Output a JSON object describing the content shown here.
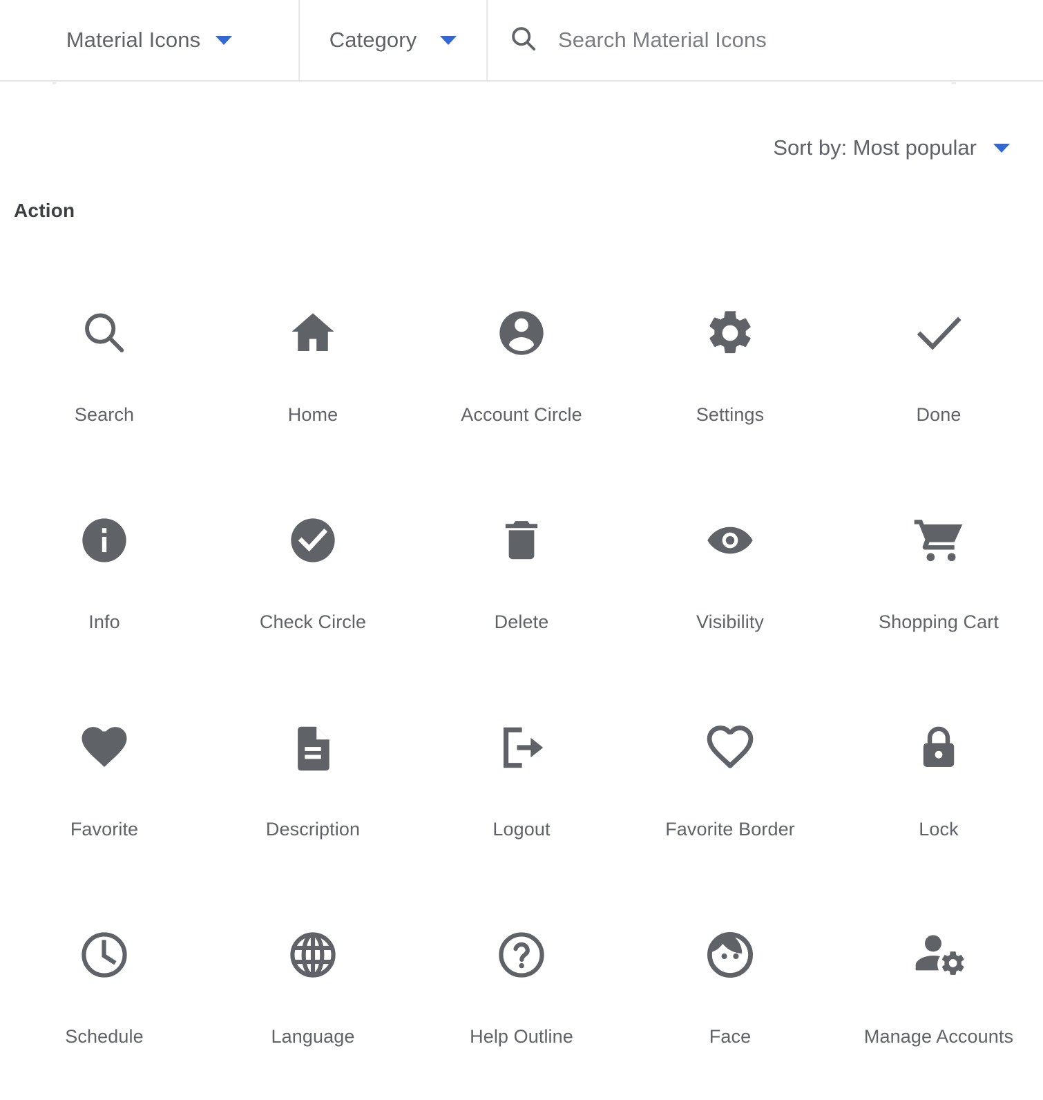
{
  "toolbar": {
    "iconset_label": "Material Icons",
    "category_label": "Category",
    "search_placeholder": "Search Material Icons",
    "search_value": "",
    "search_icon": "search-icon",
    "caret_icon": "chevron-down-icon",
    "caret_color": "#3367d6"
  },
  "sort": {
    "label": "Sort by: Most popular",
    "caret_icon": "chevron-down-icon"
  },
  "section": {
    "heading": "Action"
  },
  "colors": {
    "icon_fill": "#5f6368",
    "label_text": "#5f6368",
    "heading_text": "#3c4043",
    "accent_blue": "#3367d6",
    "divider": "#e7e7ec",
    "background": "#ffffff"
  },
  "grid": {
    "columns": 5,
    "items": [
      {
        "label": "Search",
        "icon": "search-icon"
      },
      {
        "label": "Home",
        "icon": "home-icon"
      },
      {
        "label": "Account Circle",
        "icon": "account-circle-icon"
      },
      {
        "label": "Settings",
        "icon": "gear-icon"
      },
      {
        "label": "Done",
        "icon": "check-icon"
      },
      {
        "label": "Info",
        "icon": "info-icon"
      },
      {
        "label": "Check Circle",
        "icon": "check-circle-icon"
      },
      {
        "label": "Delete",
        "icon": "trash-icon"
      },
      {
        "label": "Visibility",
        "icon": "eye-icon"
      },
      {
        "label": "Shopping Cart",
        "icon": "shopping-cart-icon"
      },
      {
        "label": "Favorite",
        "icon": "heart-filled-icon"
      },
      {
        "label": "Description",
        "icon": "document-icon"
      },
      {
        "label": "Logout",
        "icon": "logout-icon"
      },
      {
        "label": "Favorite Border",
        "icon": "heart-outline-icon"
      },
      {
        "label": "Lock",
        "icon": "lock-icon"
      },
      {
        "label": "Schedule",
        "icon": "clock-icon"
      },
      {
        "label": "Language",
        "icon": "globe-icon"
      },
      {
        "label": "Help Outline",
        "icon": "help-outline-icon"
      },
      {
        "label": "Face",
        "icon": "face-icon"
      },
      {
        "label": "Manage Accounts",
        "icon": "manage-accounts-icon"
      }
    ]
  }
}
